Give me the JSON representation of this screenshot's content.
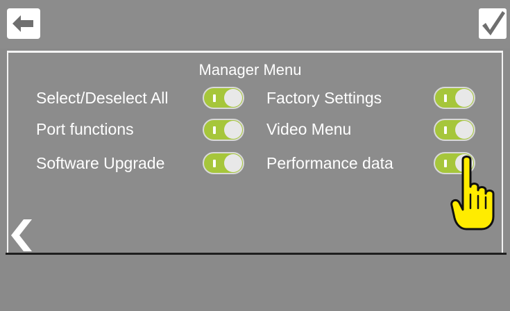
{
  "header": {
    "back_icon": "arrow-left-icon",
    "confirm_icon": "checkmark-icon"
  },
  "menu": {
    "title": "Manager Menu",
    "options": [
      {
        "label": "Select/Deselect All",
        "enabled": true
      },
      {
        "label": "Factory Settings",
        "enabled": true
      },
      {
        "label": "Port functions",
        "enabled": true
      },
      {
        "label": "Video Menu",
        "enabled": true
      },
      {
        "label": "Software Upgrade",
        "enabled": true
      },
      {
        "label": "Performance data",
        "enabled": true
      }
    ]
  },
  "navigation": {
    "previous_icon": "chevron-left-icon"
  },
  "pointer": {
    "icon": "hand-pointer-icon"
  },
  "colors": {
    "background": "#8a8a8a",
    "toggle_on": "#a6c63b",
    "toggle_knob": "#e8e8e8",
    "text": "#ffffff",
    "cursor": "#ffec00"
  }
}
